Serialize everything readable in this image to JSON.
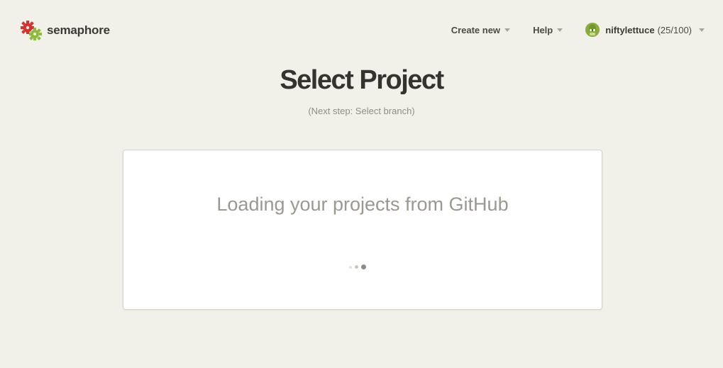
{
  "header": {
    "logo_text": "semaphore",
    "nav": {
      "create_new": "Create new",
      "help": "Help",
      "user_name": "niftylettuce",
      "user_count": "(25/100)"
    }
  },
  "main": {
    "title": "Select Project",
    "subtitle": "(Next step: Select branch)",
    "card": {
      "loading_text": "Loading your projects from GitHub"
    }
  },
  "icons": {
    "logo": "semaphore-gear-logo-icon",
    "caret": "chevron-down-icon",
    "avatar": "user-avatar-icon",
    "spinner": "loading-dots-icon"
  },
  "colors": {
    "background": "#f2f1e9",
    "logo_red": "#d8302a",
    "logo_green": "#8dbb3a",
    "card_background": "#ffffff"
  }
}
